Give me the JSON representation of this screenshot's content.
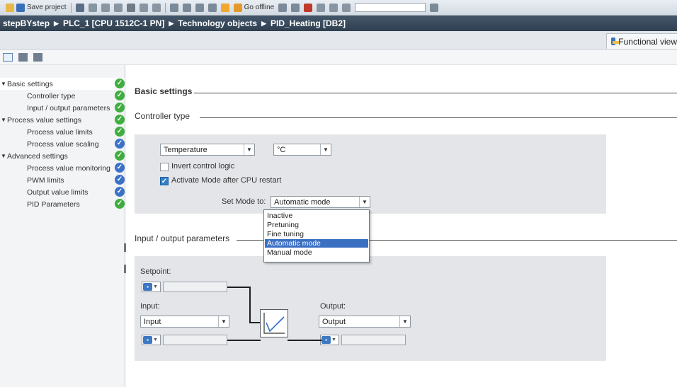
{
  "toolbar": {
    "save_label": "Save project",
    "go_offline_label": "Go offline"
  },
  "breadcrumb": [
    "stepBYstep",
    "PLC_1 [CPU 1512C-1 PN]",
    "Technology objects",
    "PID_Heating [DB2]"
  ],
  "view": {
    "functional_view_label": "Functional view"
  },
  "nav": {
    "items": [
      {
        "label": "Basic settings",
        "level": 0,
        "expanded": true,
        "selected": true,
        "status": "ok"
      },
      {
        "label": "Controller type",
        "level": 1,
        "status": "ok"
      },
      {
        "label": "Input / output parameters",
        "level": 1,
        "status": "ok"
      },
      {
        "label": "Process value settings",
        "level": 0,
        "expanded": true,
        "status": "ok"
      },
      {
        "label": "Process value limits",
        "level": 1,
        "status": "ok"
      },
      {
        "label": "Process value scaling",
        "level": 1,
        "status": "default"
      },
      {
        "label": "Advanced settings",
        "level": 0,
        "expanded": true,
        "status": "ok"
      },
      {
        "label": "Process value monitoring",
        "level": 1,
        "status": "default"
      },
      {
        "label": "PWM limits",
        "level": 1,
        "status": "default"
      },
      {
        "label": "Output value limits",
        "level": 1,
        "status": "default"
      },
      {
        "label": "PID Parameters",
        "level": 1,
        "status": "ok"
      }
    ]
  },
  "colors": {
    "status_ok": "#3fae3f",
    "status_default": "#3a72c8",
    "accent": "#3b6fc2"
  },
  "basic_settings": {
    "title": "Basic settings"
  },
  "controller_type": {
    "title": "Controller type",
    "type_value": "Temperature",
    "unit_value": "°C",
    "invert_label": "Invert control logic",
    "invert_checked": false,
    "activate_label": "Activate Mode after CPU restart",
    "activate_checked": true,
    "set_mode_label": "Set Mode to:",
    "set_mode_value": "Automatic mode",
    "mode_options": [
      "Inactive",
      "Pretuning",
      "Fine tuning",
      "Automatic mode",
      "Manual mode"
    ],
    "mode_selected": "Automatic mode"
  },
  "io_params": {
    "title": "Input / output parameters",
    "setpoint_label": "Setpoint:",
    "input_label": "Input:",
    "input_value": "Input",
    "output_label": "Output:",
    "output_value": "Output"
  }
}
